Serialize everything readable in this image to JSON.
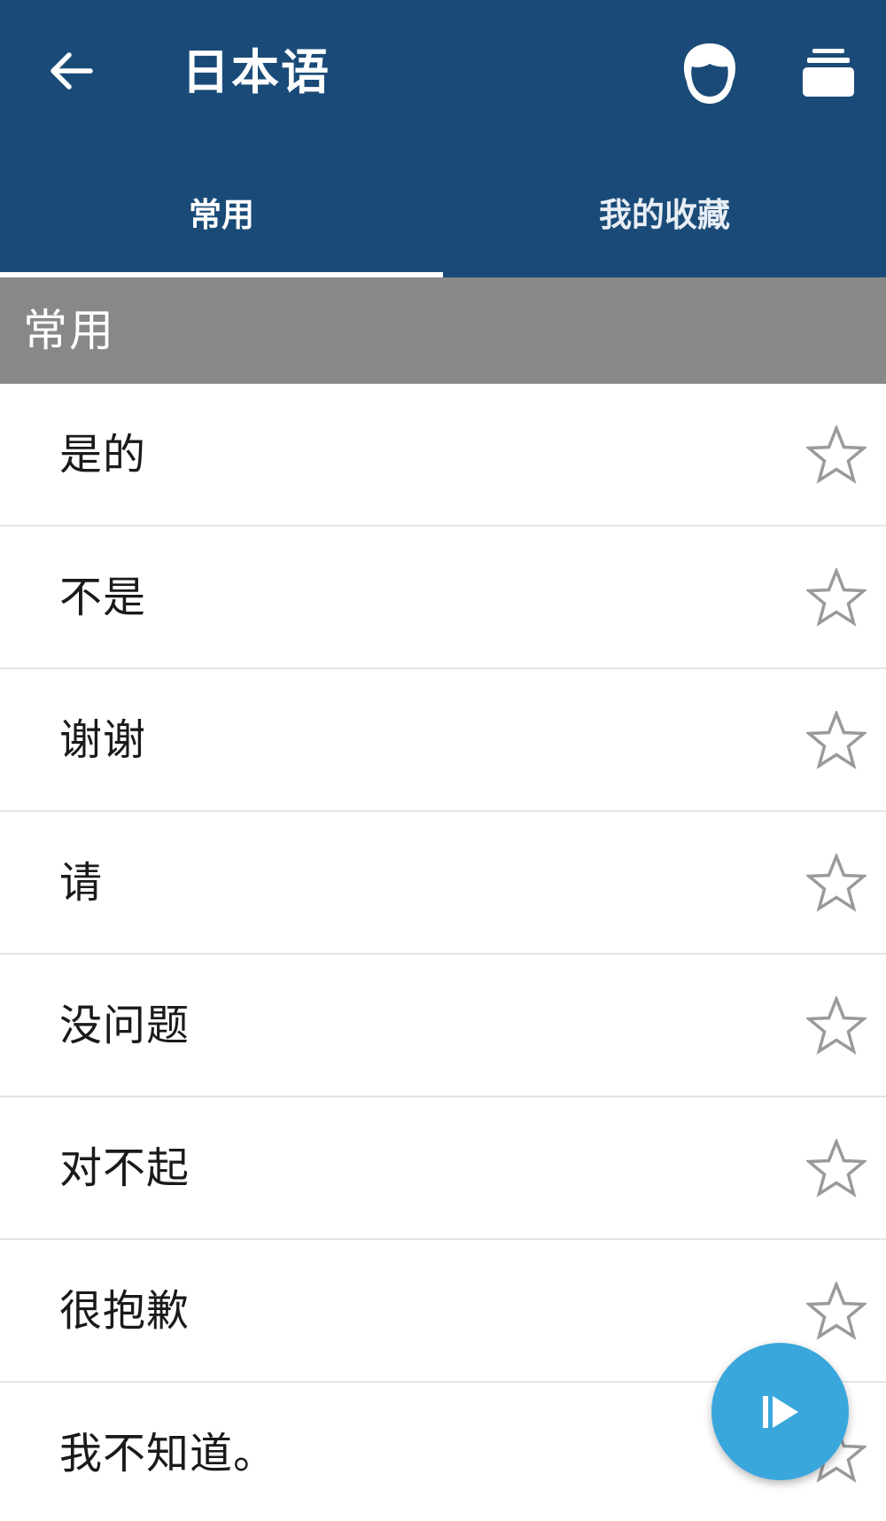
{
  "header": {
    "title": "日本语",
    "back_icon": "arrow-left-icon",
    "voice_icon": "face-icon",
    "cards_icon": "stack-cards-icon",
    "background_color": "#1a4b78"
  },
  "tabs": [
    {
      "label": "常用",
      "selected": true
    },
    {
      "label": "我的收藏",
      "selected": false
    }
  ],
  "section": {
    "title": "常用",
    "background_color": "#888888"
  },
  "phrases": [
    {
      "label": "是的",
      "favorited": false
    },
    {
      "label": "不是",
      "favorited": false
    },
    {
      "label": "谢谢",
      "favorited": false
    },
    {
      "label": "请",
      "favorited": false
    },
    {
      "label": "没问题",
      "favorited": false
    },
    {
      "label": "对不起",
      "favorited": false
    },
    {
      "label": "很抱歉",
      "favorited": false
    },
    {
      "label": "我不知道。",
      "favorited": false
    }
  ],
  "fab": {
    "icon": "play-icon",
    "color": "#3aa7dc"
  }
}
